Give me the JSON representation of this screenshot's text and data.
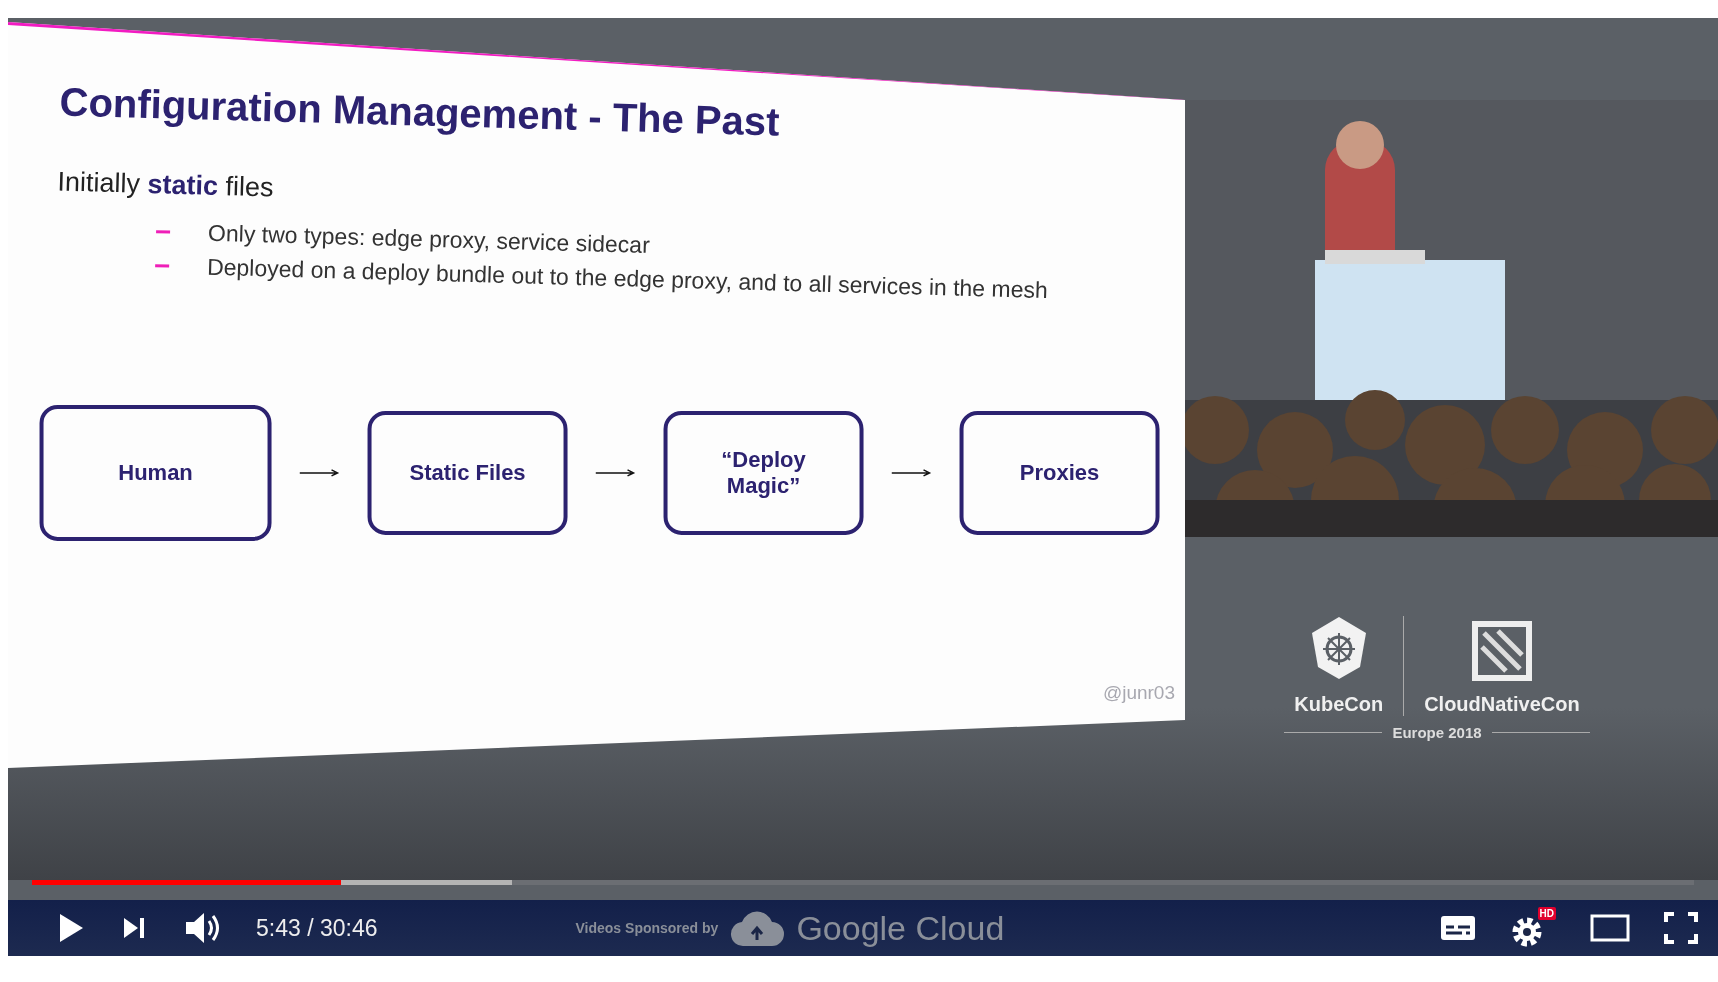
{
  "slide": {
    "title": "Configuration Management - The Past",
    "lead": "Initially **static** files",
    "bullets": [
      "Only two types: edge proxy, service sidecar",
      "Deployed on a deploy bundle out to the edge proxy, and to all services in the mesh"
    ],
    "flow": [
      "Human",
      "Static Files",
      "“Deploy Magic”",
      "Proxies"
    ],
    "handle": "@junr03"
  },
  "event_logo": {
    "left": "KubeCon",
    "right": "CloudNativeCon",
    "edition": "Europe 2018"
  },
  "player": {
    "progress": {
      "level": 0.186
    },
    "buffer": {
      "level": 0.289
    },
    "time": "5:43 / 30:46",
    "sponsor_label": "Videos Sponsored by",
    "sponsor": "Google Cloud",
    "hd_badge": "HD"
  }
}
